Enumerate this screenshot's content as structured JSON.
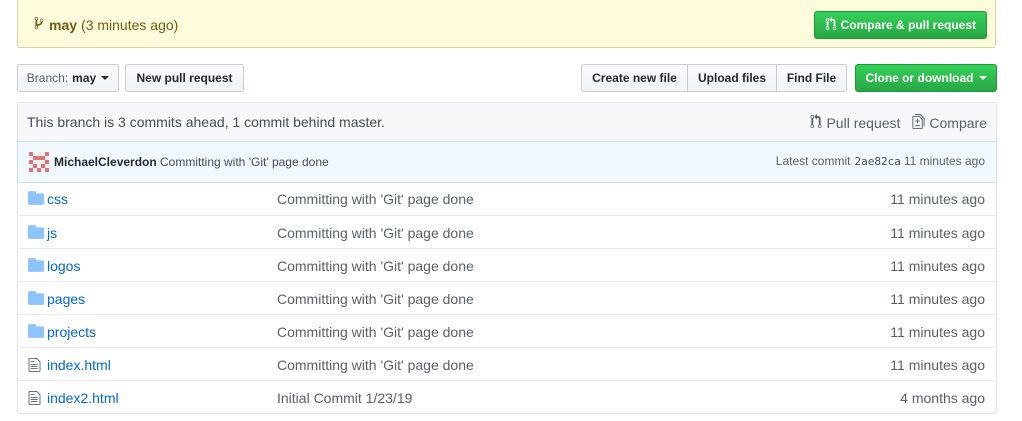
{
  "banner": {
    "branch": "may",
    "ago": "(3 minutes ago)",
    "compare_button": "Compare & pull request",
    "background": "#fffbdd"
  },
  "toolbar": {
    "branch_label": "Branch:",
    "branch_value": "may",
    "new_pr": "New pull request",
    "create_file": "Create new file",
    "upload_files": "Upload files",
    "find_file": "Find File",
    "clone": "Clone or download",
    "accent": "#28a745"
  },
  "ahead": {
    "text": "This branch is 3 commits ahead, 1 commit behind master.",
    "pull_request": "Pull request",
    "compare": "Compare"
  },
  "commit": {
    "author": "MichaelCleverdon",
    "message": "Committing with 'Git' page done",
    "latest_label": "Latest commit",
    "sha": "2ae82ca",
    "age": "11 minutes ago"
  },
  "files": [
    {
      "name": "css",
      "type": "folder-icon",
      "message": "Committing with 'Git' page done",
      "age": "11 minutes ago"
    },
    {
      "name": "js",
      "type": "folder-icon",
      "message": "Committing with 'Git' page done",
      "age": "11 minutes ago"
    },
    {
      "name": "logos",
      "type": "folder-icon",
      "message": "Committing with 'Git' page done",
      "age": "11 minutes ago"
    },
    {
      "name": "pages",
      "type": "folder-icon",
      "message": "Committing with 'Git' page done",
      "age": "11 minutes ago"
    },
    {
      "name": "projects",
      "type": "folder-icon",
      "message": "Committing with 'Git' page done",
      "age": "11 minutes ago"
    },
    {
      "name": "index.html",
      "type": "file-icon",
      "message": "Committing with 'Git' page done",
      "age": "11 minutes ago"
    },
    {
      "name": "index2.html",
      "type": "file-icon",
      "message": "Initial Commit 1/23/19",
      "age": "4 months ago"
    }
  ]
}
